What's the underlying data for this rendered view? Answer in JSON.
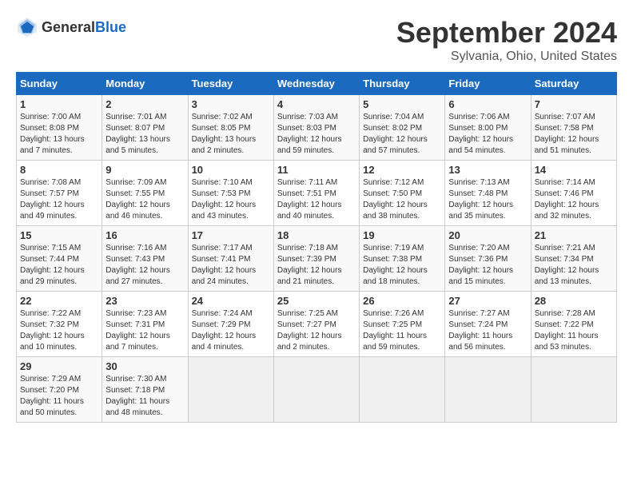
{
  "logo": {
    "text_general": "General",
    "text_blue": "Blue"
  },
  "header": {
    "month": "September 2024",
    "location": "Sylvania, Ohio, United States"
  },
  "weekdays": [
    "Sunday",
    "Monday",
    "Tuesday",
    "Wednesday",
    "Thursday",
    "Friday",
    "Saturday"
  ],
  "weeks": [
    [
      {
        "day": "1",
        "sunrise": "Sunrise: 7:00 AM",
        "sunset": "Sunset: 8:08 PM",
        "daylight": "Daylight: 13 hours and 7 minutes."
      },
      {
        "day": "2",
        "sunrise": "Sunrise: 7:01 AM",
        "sunset": "Sunset: 8:07 PM",
        "daylight": "Daylight: 13 hours and 5 minutes."
      },
      {
        "day": "3",
        "sunrise": "Sunrise: 7:02 AM",
        "sunset": "Sunset: 8:05 PM",
        "daylight": "Daylight: 13 hours and 2 minutes."
      },
      {
        "day": "4",
        "sunrise": "Sunrise: 7:03 AM",
        "sunset": "Sunset: 8:03 PM",
        "daylight": "Daylight: 12 hours and 59 minutes."
      },
      {
        "day": "5",
        "sunrise": "Sunrise: 7:04 AM",
        "sunset": "Sunset: 8:02 PM",
        "daylight": "Daylight: 12 hours and 57 minutes."
      },
      {
        "day": "6",
        "sunrise": "Sunrise: 7:06 AM",
        "sunset": "Sunset: 8:00 PM",
        "daylight": "Daylight: 12 hours and 54 minutes."
      },
      {
        "day": "7",
        "sunrise": "Sunrise: 7:07 AM",
        "sunset": "Sunset: 7:58 PM",
        "daylight": "Daylight: 12 hours and 51 minutes."
      }
    ],
    [
      {
        "day": "8",
        "sunrise": "Sunrise: 7:08 AM",
        "sunset": "Sunset: 7:57 PM",
        "daylight": "Daylight: 12 hours and 49 minutes."
      },
      {
        "day": "9",
        "sunrise": "Sunrise: 7:09 AM",
        "sunset": "Sunset: 7:55 PM",
        "daylight": "Daylight: 12 hours and 46 minutes."
      },
      {
        "day": "10",
        "sunrise": "Sunrise: 7:10 AM",
        "sunset": "Sunset: 7:53 PM",
        "daylight": "Daylight: 12 hours and 43 minutes."
      },
      {
        "day": "11",
        "sunrise": "Sunrise: 7:11 AM",
        "sunset": "Sunset: 7:51 PM",
        "daylight": "Daylight: 12 hours and 40 minutes."
      },
      {
        "day": "12",
        "sunrise": "Sunrise: 7:12 AM",
        "sunset": "Sunset: 7:50 PM",
        "daylight": "Daylight: 12 hours and 38 minutes."
      },
      {
        "day": "13",
        "sunrise": "Sunrise: 7:13 AM",
        "sunset": "Sunset: 7:48 PM",
        "daylight": "Daylight: 12 hours and 35 minutes."
      },
      {
        "day": "14",
        "sunrise": "Sunrise: 7:14 AM",
        "sunset": "Sunset: 7:46 PM",
        "daylight": "Daylight: 12 hours and 32 minutes."
      }
    ],
    [
      {
        "day": "15",
        "sunrise": "Sunrise: 7:15 AM",
        "sunset": "Sunset: 7:44 PM",
        "daylight": "Daylight: 12 hours and 29 minutes."
      },
      {
        "day": "16",
        "sunrise": "Sunrise: 7:16 AM",
        "sunset": "Sunset: 7:43 PM",
        "daylight": "Daylight: 12 hours and 27 minutes."
      },
      {
        "day": "17",
        "sunrise": "Sunrise: 7:17 AM",
        "sunset": "Sunset: 7:41 PM",
        "daylight": "Daylight: 12 hours and 24 minutes."
      },
      {
        "day": "18",
        "sunrise": "Sunrise: 7:18 AM",
        "sunset": "Sunset: 7:39 PM",
        "daylight": "Daylight: 12 hours and 21 minutes."
      },
      {
        "day": "19",
        "sunrise": "Sunrise: 7:19 AM",
        "sunset": "Sunset: 7:38 PM",
        "daylight": "Daylight: 12 hours and 18 minutes."
      },
      {
        "day": "20",
        "sunrise": "Sunrise: 7:20 AM",
        "sunset": "Sunset: 7:36 PM",
        "daylight": "Daylight: 12 hours and 15 minutes."
      },
      {
        "day": "21",
        "sunrise": "Sunrise: 7:21 AM",
        "sunset": "Sunset: 7:34 PM",
        "daylight": "Daylight: 12 hours and 13 minutes."
      }
    ],
    [
      {
        "day": "22",
        "sunrise": "Sunrise: 7:22 AM",
        "sunset": "Sunset: 7:32 PM",
        "daylight": "Daylight: 12 hours and 10 minutes."
      },
      {
        "day": "23",
        "sunrise": "Sunrise: 7:23 AM",
        "sunset": "Sunset: 7:31 PM",
        "daylight": "Daylight: 12 hours and 7 minutes."
      },
      {
        "day": "24",
        "sunrise": "Sunrise: 7:24 AM",
        "sunset": "Sunset: 7:29 PM",
        "daylight": "Daylight: 12 hours and 4 minutes."
      },
      {
        "day": "25",
        "sunrise": "Sunrise: 7:25 AM",
        "sunset": "Sunset: 7:27 PM",
        "daylight": "Daylight: 12 hours and 2 minutes."
      },
      {
        "day": "26",
        "sunrise": "Sunrise: 7:26 AM",
        "sunset": "Sunset: 7:25 PM",
        "daylight": "Daylight: 11 hours and 59 minutes."
      },
      {
        "day": "27",
        "sunrise": "Sunrise: 7:27 AM",
        "sunset": "Sunset: 7:24 PM",
        "daylight": "Daylight: 11 hours and 56 minutes."
      },
      {
        "day": "28",
        "sunrise": "Sunrise: 7:28 AM",
        "sunset": "Sunset: 7:22 PM",
        "daylight": "Daylight: 11 hours and 53 minutes."
      }
    ],
    [
      {
        "day": "29",
        "sunrise": "Sunrise: 7:29 AM",
        "sunset": "Sunset: 7:20 PM",
        "daylight": "Daylight: 11 hours and 50 minutes."
      },
      {
        "day": "30",
        "sunrise": "Sunrise: 7:30 AM",
        "sunset": "Sunset: 7:18 PM",
        "daylight": "Daylight: 11 hours and 48 minutes."
      },
      null,
      null,
      null,
      null,
      null
    ]
  ]
}
